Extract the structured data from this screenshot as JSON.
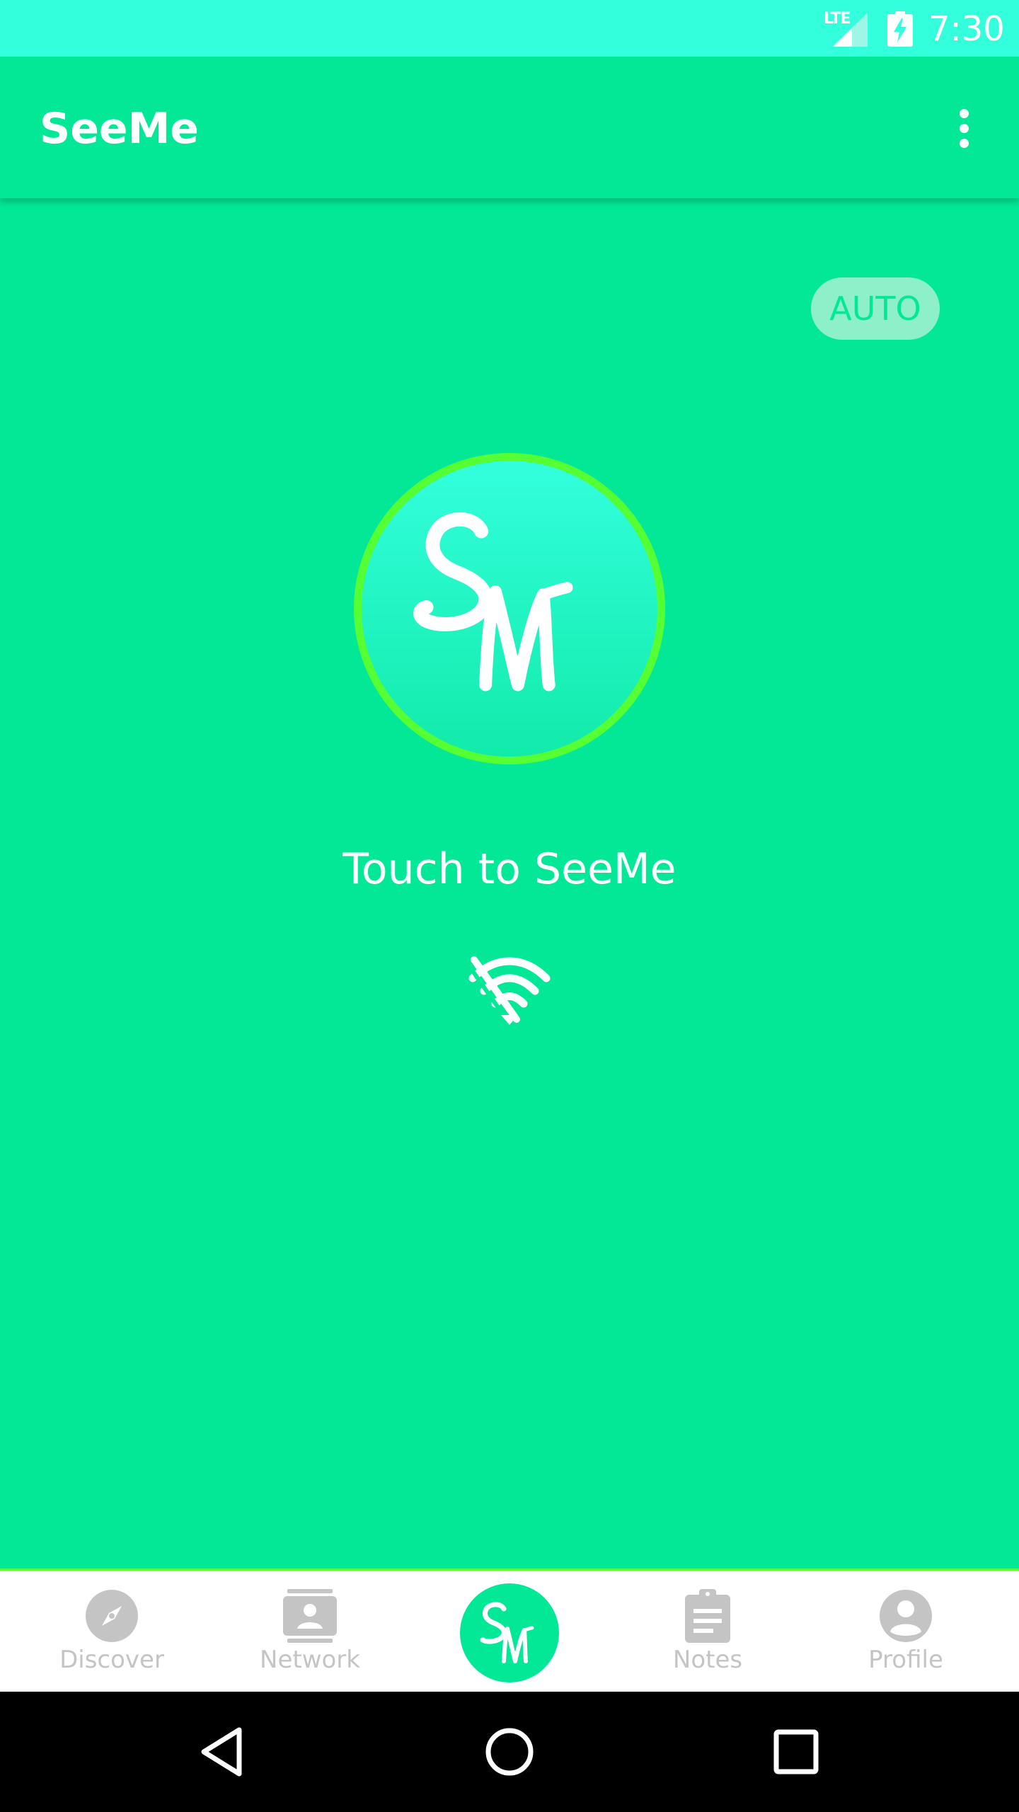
{
  "status_bar": {
    "network": "LTE",
    "time": "7:30"
  },
  "app_bar": {
    "title": "SeeMe",
    "menu_icon": "more-vert-icon"
  },
  "mode_chip": {
    "label": "AUTO"
  },
  "main": {
    "logo": "SM",
    "touch_label": "Touch to SeeMe",
    "connectivity_icon": "wifi-off-icon"
  },
  "bottom_nav": {
    "items": [
      {
        "label": "Discover",
        "icon": "compass-icon"
      },
      {
        "label": "Network",
        "icon": "contacts-icon"
      },
      {
        "label": "SM",
        "icon": "seeme-logo-icon"
      },
      {
        "label": "Notes",
        "icon": "clipboard-icon"
      },
      {
        "label": "Profile",
        "icon": "account-circle-icon"
      }
    ]
  },
  "colors": {
    "primary": "#02e896",
    "status_bar": "#33ffdd",
    "ring": "#55ff33",
    "nav_inactive": "#c4c4c4"
  }
}
